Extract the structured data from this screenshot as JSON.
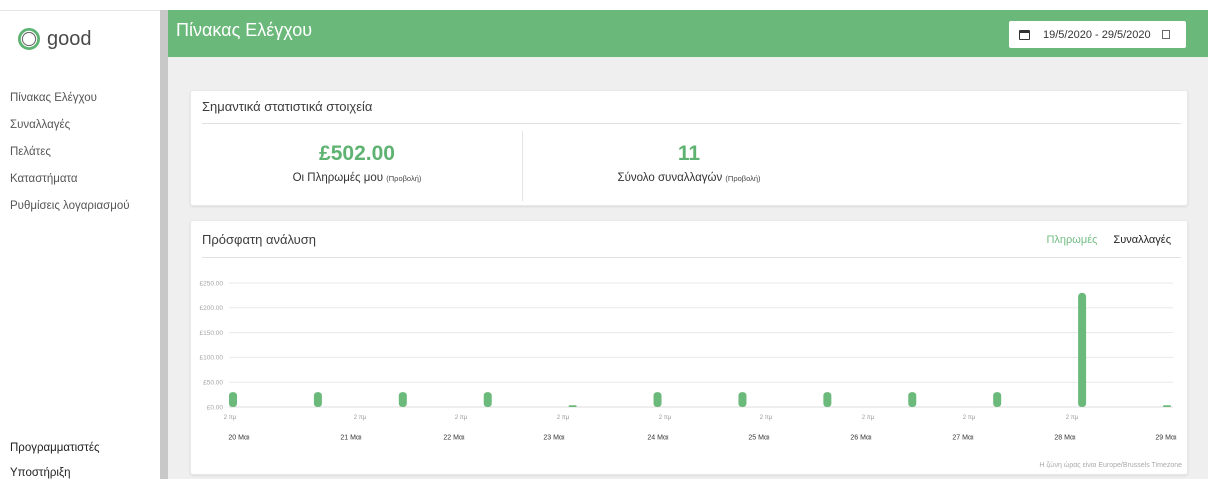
{
  "app": {
    "logo_text": "good",
    "logo_icon": "ring-logo-icon"
  },
  "sidebar": {
    "items": [
      {
        "label": "Πίνακας Ελέγχου"
      },
      {
        "label": "Συναλλαγές"
      },
      {
        "label": "Πελάτες"
      },
      {
        "label": "Καταστήματα"
      },
      {
        "label": "Ρυθμίσεις λογαριασμού"
      }
    ],
    "bottom_items": [
      {
        "label": "Προγραμματιστές"
      },
      {
        "label": "Υποστήριξη"
      }
    ]
  },
  "header": {
    "title": "Πίνακας Ελέγχου",
    "date_range": "19/5/2020 - 29/5/2020",
    "date_icon": "calendar-icon",
    "date_trailing_icon": "square-icon"
  },
  "stats": {
    "title": "Σημαντικά στατιστικά στοιχεία",
    "items": [
      {
        "value": "£502.00",
        "label": "Οι Πληρωμές μου",
        "link": "(Προβολή)"
      },
      {
        "value": "11",
        "label": "Σύνολο συναλλαγών",
        "link": "(Προβολή)"
      }
    ]
  },
  "analysis": {
    "tabs": [
      {
        "label": "Πληρωμές",
        "active": true
      },
      {
        "label": "Συναλλαγές",
        "active": false
      }
    ],
    "timezone_note": "Η ζώνη ώρας είναι Europe/Brussels Timezone"
  },
  "colors": {
    "header_green": "#6ab87a",
    "value_green": "#5eb372",
    "bar_green": "#6bb97b",
    "active_tab_green": "#72bd83",
    "page_background": "#efefef",
    "scrollbar": "#c8c8c8"
  },
  "chart_data": {
    "type": "bar",
    "title": "Πρόσφατη ανάλυση",
    "ylim": [
      0,
      250
    ],
    "y_ticks": [
      0,
      50,
      100,
      150,
      200,
      250
    ],
    "y_tick_labels": [
      "£0.00",
      "£50.00",
      "£100.00",
      "£150.00",
      "£200.00",
      "£250.00"
    ],
    "x_tick_labels": [
      "2 πμ",
      "2 πμ",
      "2 πμ",
      "2 πμ",
      "2 πμ",
      "2 πμ",
      "2 πμ",
      "2 πμ",
      "2 πμ"
    ],
    "x_date_labels": [
      "20 Μαι",
      "21 Μαι",
      "22 Μαι",
      "23 Μαι",
      "24 Μαι",
      "25 Μαι",
      "26 Μαι",
      "27 Μαι",
      "28 Μαι",
      "29 Μαι"
    ],
    "series": [
      {
        "values": [
          30,
          30,
          30,
          30,
          1,
          30,
          30,
          30,
          30,
          30,
          230,
          1
        ]
      }
    ],
    "grid": true,
    "legend": "none"
  }
}
